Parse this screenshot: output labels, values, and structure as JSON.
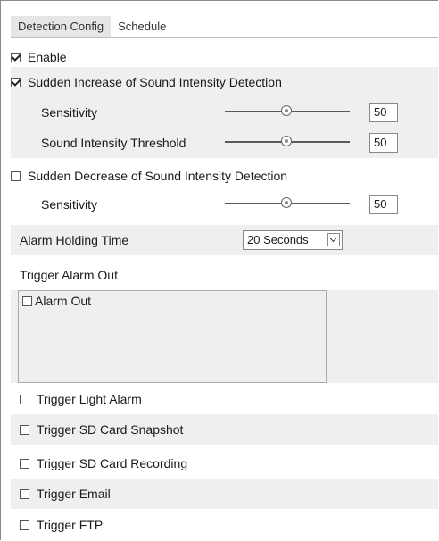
{
  "tabs": [
    "Detection Config",
    "Schedule"
  ],
  "enable": {
    "label": "Enable",
    "checked": true
  },
  "sudden_increase": {
    "label": "Sudden Increase of Sound Intensity Detection",
    "checked": true,
    "sensitivity_label": "Sensitivity",
    "sensitivity_value": "50",
    "threshold_label": "Sound Intensity Threshold",
    "threshold_value": "50"
  },
  "sudden_decrease": {
    "label": "Sudden Decrease of Sound Intensity Detection",
    "checked": false,
    "sensitivity_label": "Sensitivity",
    "sensitivity_value": "50"
  },
  "alarm_holding": {
    "label": "Alarm Holding Time",
    "value": "20 Seconds"
  },
  "trigger_alarm_out": {
    "label": "Trigger Alarm Out",
    "item": "Alarm Out"
  },
  "triggers": [
    "Trigger Light Alarm",
    "Trigger SD Card Snapshot",
    "Trigger SD Card Recording",
    "Trigger Email",
    "Trigger FTP"
  ]
}
